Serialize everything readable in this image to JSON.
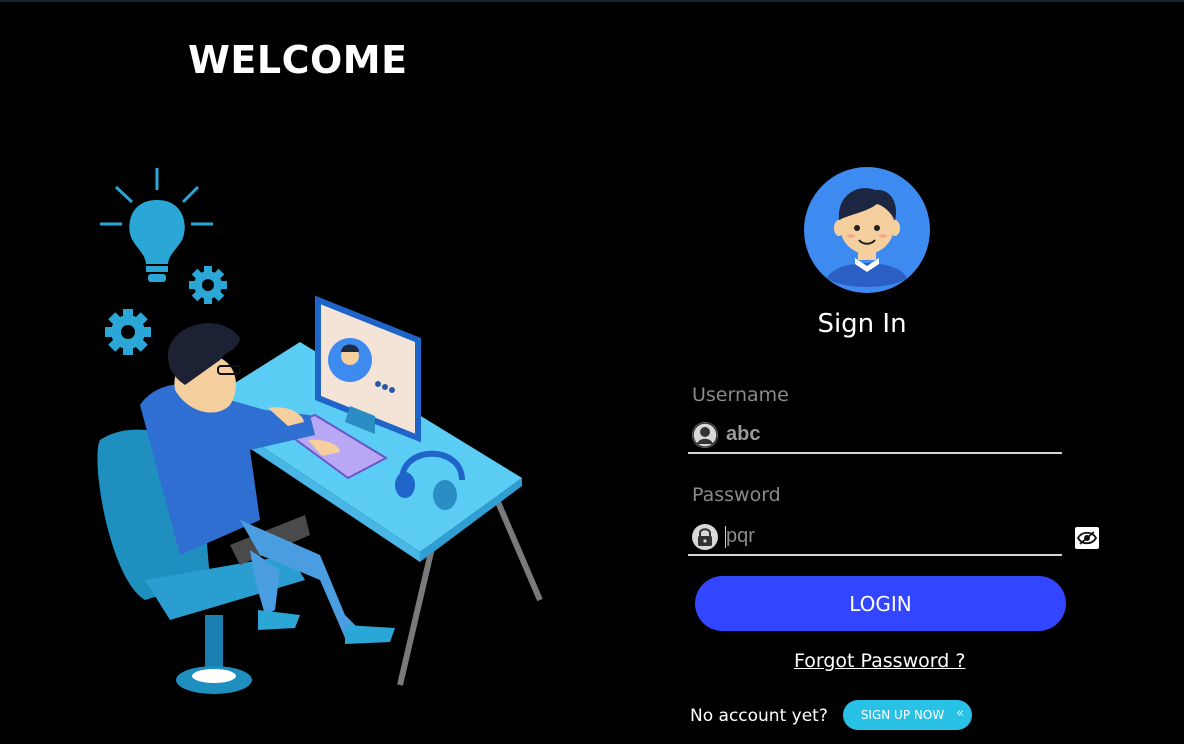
{
  "header": {
    "welcome_text": "WELCOME"
  },
  "signin": {
    "title": "Sign In",
    "username_label": "Username",
    "username_value": "abc",
    "password_label": "Password",
    "password_value": "pqr",
    "login_label": "LOGIN",
    "forgot_label": "Forgot Password ?",
    "no_account_text": "No account yet?",
    "signup_label": "SIGN UP NOW",
    "signup_arrows": "«"
  },
  "colors": {
    "background": "#000000",
    "login_button": "#3245ff",
    "signup_button": "#29c2e6",
    "accent_blue": "#2aa7d6",
    "avatar_bg": "#3d8bf0"
  },
  "icons": {
    "username": "user-icon",
    "password": "lock-icon",
    "toggle": "eye-slash-icon"
  }
}
